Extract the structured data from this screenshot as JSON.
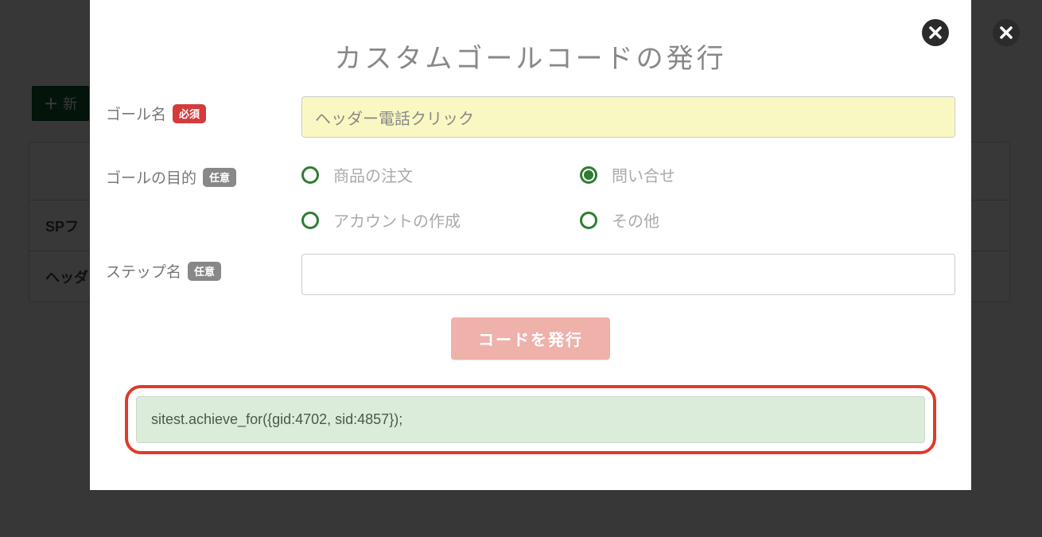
{
  "background": {
    "new_button_label": "新",
    "row1": "",
    "row2": "SPフ",
    "row3": "ヘッダ"
  },
  "modal": {
    "title": "カスタムゴールコードの発行",
    "goal_name": {
      "label": "ゴール名",
      "badge": "必須",
      "value": "ヘッダー電話クリック"
    },
    "goal_purpose": {
      "label": "ゴールの目的",
      "badge": "任意",
      "options": {
        "order": "商品の注文",
        "inquiry": "問い合せ",
        "account": "アカウントの作成",
        "other": "その他"
      },
      "selected": "inquiry"
    },
    "step_name": {
      "label": "ステップ名",
      "badge": "任意",
      "value": ""
    },
    "issue_button": "コードを発行",
    "code_output": "sitest.achieve_for({gid:4702, sid:4857});"
  }
}
